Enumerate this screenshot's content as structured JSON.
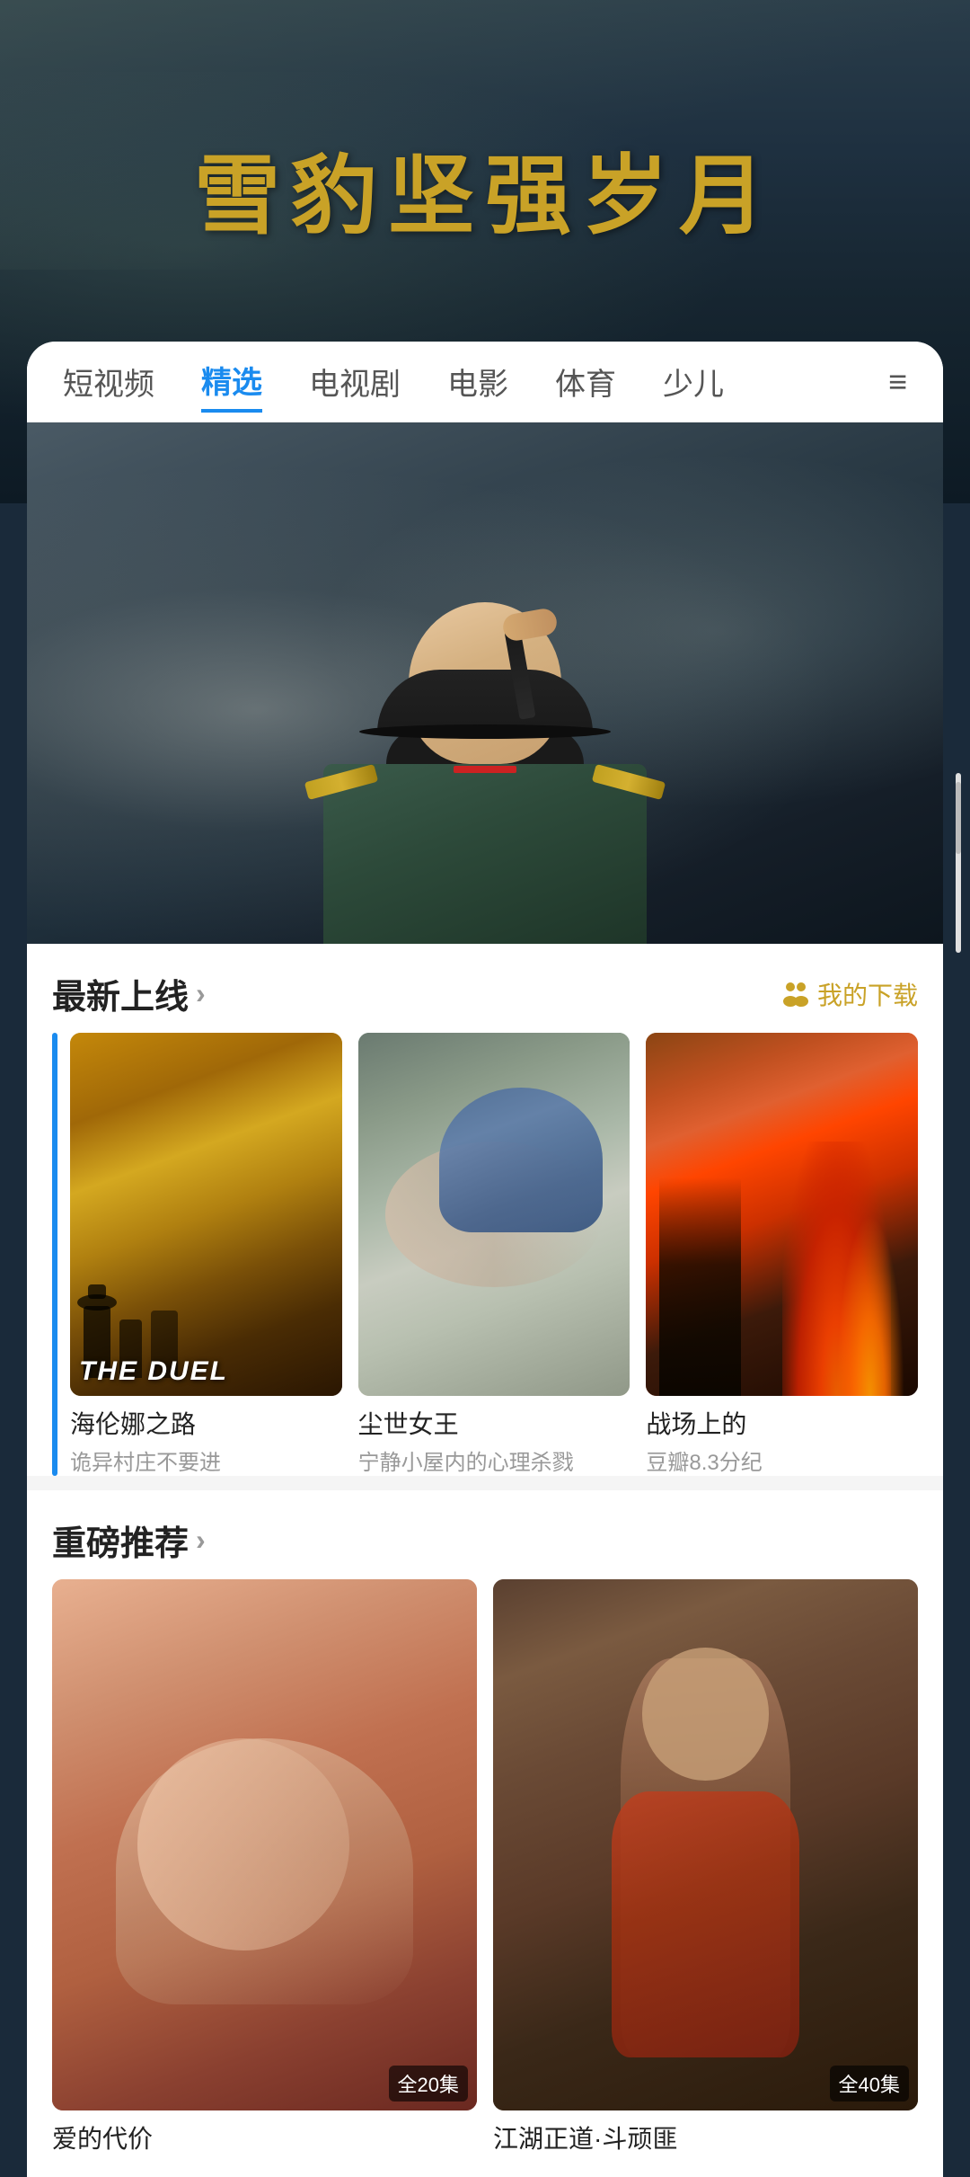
{
  "hero": {
    "title": "雪豹坚强岁月",
    "bg_color_start": "#2c3e50",
    "bg_color_end": "#1a252f"
  },
  "nav": {
    "tabs": [
      {
        "id": "short",
        "label": "短视频",
        "active": false
      },
      {
        "id": "featured",
        "label": "精选",
        "active": true
      },
      {
        "id": "tv",
        "label": "电视剧",
        "active": false
      },
      {
        "id": "movie",
        "label": "电影",
        "active": false
      },
      {
        "id": "sports",
        "label": "体育",
        "active": false
      },
      {
        "id": "children",
        "label": "少儿",
        "active": false
      }
    ],
    "menu_icon": "≡"
  },
  "new_releases": {
    "section_title": "最新上线",
    "section_arrow": "›",
    "download_label": "我的下载",
    "items": [
      {
        "id": "duel",
        "title": "海伦娜之路",
        "subtitle": "诡异村庄不要进",
        "thumb_label": "THE DUEL"
      },
      {
        "id": "queen",
        "title": "尘世女王",
        "subtitle": "宁静小屋内的心理杀戮"
      },
      {
        "id": "battle",
        "title": "战场上的",
        "subtitle": "豆瓣8.3分纪"
      }
    ]
  },
  "recommendations": {
    "section_title": "重磅推荐",
    "section_arrow": "›",
    "items": [
      {
        "id": "love",
        "title": "爱的代价",
        "episode_count": "全20集"
      },
      {
        "id": "river",
        "title": "江湖正道·斗顽匪",
        "episode_count": "全40集"
      }
    ]
  }
}
